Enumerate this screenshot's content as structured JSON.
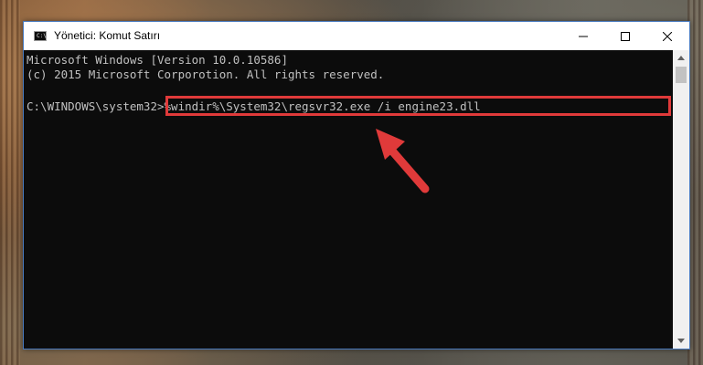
{
  "window": {
    "title": "Yönetici: Komut Satırı",
    "icon": "cmd-icon",
    "icon_glyph": "C:\\",
    "controls": {
      "minimize": "minimize-icon",
      "maximize": "maximize-icon",
      "close": "close-icon"
    }
  },
  "console": {
    "lines": [
      "Microsoft Windows [Version 10.0.10586]",
      "(c) 2015 Microsoft Corporotion. All rights reserved."
    ],
    "prompt": "C:\\WINDOWS\\system32>",
    "command": "%windir%\\System32\\regsvr32.exe /i engine23.dll"
  },
  "annotation": {
    "highlight_color": "#e03a3a",
    "arrow_color": "#e03a3a"
  }
}
